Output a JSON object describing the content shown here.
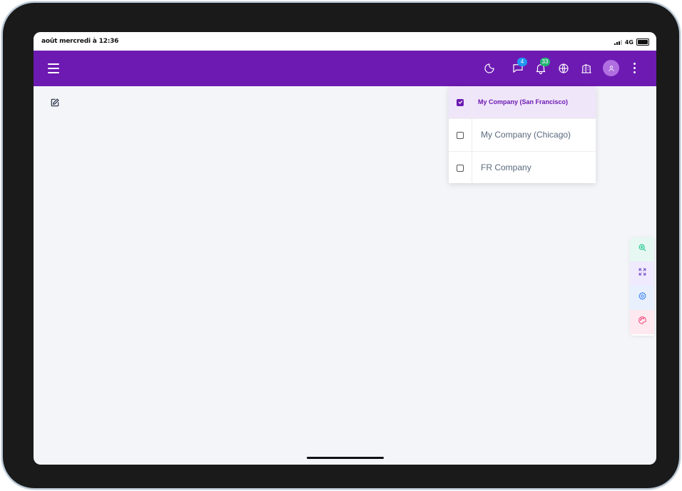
{
  "status_bar": {
    "time": "août mercredi à 12:36",
    "network": "4G"
  },
  "topbar": {
    "menu_icon": "hamburger-icon",
    "icons": [
      "moon-icon",
      "chat-icon",
      "bell-icon",
      "globe-icon",
      "building-icon",
      "user-icon",
      "more-vertical-icon"
    ],
    "chat_badge": "4",
    "notification_badge": "33",
    "colors": {
      "background": "#6d1ab2",
      "chat_badge": "#2196f3",
      "notification_badge": "#22b573"
    }
  },
  "page": {
    "edit_icon": "edit-icon"
  },
  "company_dropdown": {
    "items": [
      {
        "label": "My Company (San Francisco)",
        "checked": true
      },
      {
        "label": "My Company (Chicago)",
        "checked": false
      },
      {
        "label": "FR Company",
        "checked": false
      }
    ]
  },
  "quick_actions": {
    "icons": [
      "zoom-in-icon",
      "fullscreen-icon",
      "settings-icon",
      "palette-icon"
    ],
    "colors": {
      "zoom": "#1cc88a",
      "expand": "#6f42c1",
      "settings": "#3b82f6",
      "palette": "#f0437a"
    }
  }
}
